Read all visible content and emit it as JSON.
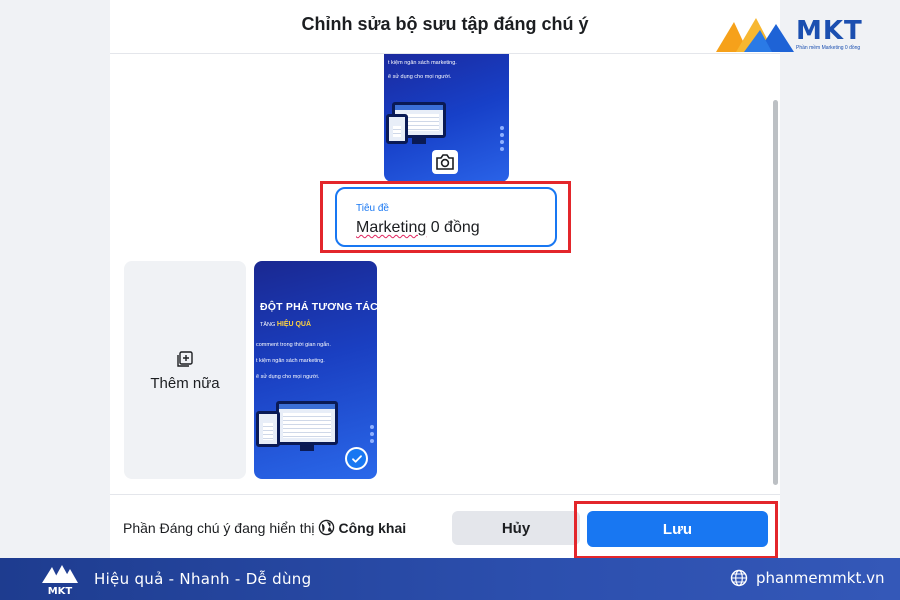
{
  "dialog": {
    "title": "Chỉnh sửa bộ sưu tập đáng chú ý"
  },
  "cover_image": {
    "lines": [
      "t kiệm ngân sách marketing.",
      "ẽ sử dụng cho mọi người."
    ],
    "camera_icon": "camera-icon"
  },
  "title_field": {
    "label": "Tiêu đề",
    "value_part1": "Marketing",
    "value_part2": " 0 đồng"
  },
  "add_more": {
    "label": "Thêm nữa",
    "icon": "add-photo-icon"
  },
  "thumbnail": {
    "headline": "ĐỘT PHÁ TƯƠNG TÁC",
    "sub_prefix": "TĂNG ",
    "sub_highlight": "HIỆU QUẢ",
    "lines": [
      "comment trong thời gian ngắn.",
      "t kiệm ngân sách marketing.",
      "ẽ sử dụng cho mọi người."
    ],
    "selected": true
  },
  "footer": {
    "visibility_text": "Phần Đáng chú ý đang hiển thị",
    "visibility_value": "Công khai",
    "cancel_label": "Hủy",
    "save_label": "Lưu"
  },
  "brand": {
    "name": "MKT",
    "tagline": "Phần mềm Marketing 0 đồng"
  },
  "bottom_bar": {
    "slogan": "Hiệu quả - Nhanh - Dễ dùng",
    "website": "phanmemmkt.vn",
    "logo_text": "MKT"
  },
  "colors": {
    "primary": "#1877f2",
    "highlight": "#e3262b",
    "bar": "#2c4fae"
  }
}
